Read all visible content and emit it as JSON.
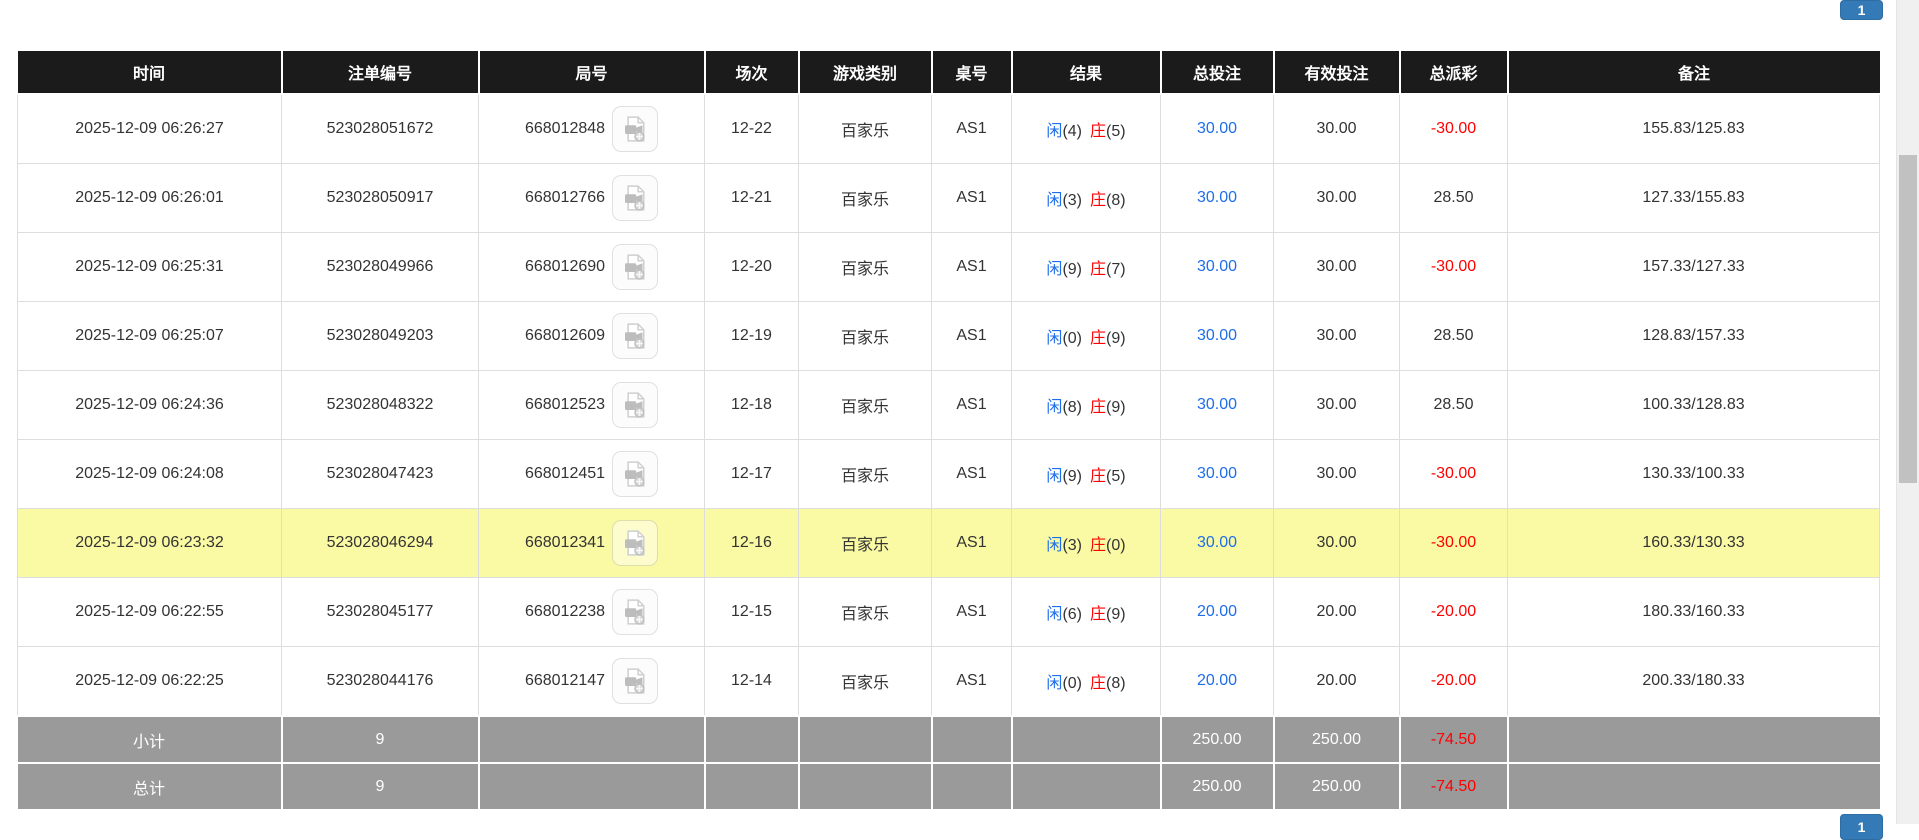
{
  "pagination": {
    "top_label": "1",
    "bottom_label": "1"
  },
  "columns": [
    "时间",
    "注单编号",
    "局号",
    "场次",
    "游戏类别",
    "桌号",
    "结果",
    "总投注",
    "有效投注",
    "总派彩",
    "备注"
  ],
  "rows": [
    {
      "time": "2025-12-09 06:26:27",
      "bet_no": "523028051672",
      "round_no": "668012848",
      "session": "12-22",
      "game": "百家乐",
      "table_no": "AS1",
      "player_label": "闲",
      "player_score": "(4)",
      "banker_label": "庄",
      "banker_score": "(5)",
      "total_bet": "30.00",
      "valid_bet": "30.00",
      "payout": "-30.00",
      "remark": "155.83/125.83"
    },
    {
      "time": "2025-12-09 06:26:01",
      "bet_no": "523028050917",
      "round_no": "668012766",
      "session": "12-21",
      "game": "百家乐",
      "table_no": "AS1",
      "player_label": "闲",
      "player_score": "(3)",
      "banker_label": "庄",
      "banker_score": "(8)",
      "total_bet": "30.00",
      "valid_bet": "30.00",
      "payout": "28.50",
      "remark": "127.33/155.83"
    },
    {
      "time": "2025-12-09 06:25:31",
      "bet_no": "523028049966",
      "round_no": "668012690",
      "session": "12-20",
      "game": "百家乐",
      "table_no": "AS1",
      "player_label": "闲",
      "player_score": "(9)",
      "banker_label": "庄",
      "banker_score": "(7)",
      "total_bet": "30.00",
      "valid_bet": "30.00",
      "payout": "-30.00",
      "remark": "157.33/127.33"
    },
    {
      "time": "2025-12-09 06:25:07",
      "bet_no": "523028049203",
      "round_no": "668012609",
      "session": "12-19",
      "game": "百家乐",
      "table_no": "AS1",
      "player_label": "闲",
      "player_score": "(0)",
      "banker_label": "庄",
      "banker_score": "(9)",
      "total_bet": "30.00",
      "valid_bet": "30.00",
      "payout": "28.50",
      "remark": "128.83/157.33"
    },
    {
      "time": "2025-12-09 06:24:36",
      "bet_no": "523028048322",
      "round_no": "668012523",
      "session": "12-18",
      "game": "百家乐",
      "table_no": "AS1",
      "player_label": "闲",
      "player_score": "(8)",
      "banker_label": "庄",
      "banker_score": "(9)",
      "total_bet": "30.00",
      "valid_bet": "30.00",
      "payout": "28.50",
      "remark": "100.33/128.83"
    },
    {
      "time": "2025-12-09 06:24:08",
      "bet_no": "523028047423",
      "round_no": "668012451",
      "session": "12-17",
      "game": "百家乐",
      "table_no": "AS1",
      "player_label": "闲",
      "player_score": "(9)",
      "banker_label": "庄",
      "banker_score": "(5)",
      "total_bet": "30.00",
      "valid_bet": "30.00",
      "payout": "-30.00",
      "remark": "130.33/100.33"
    },
    {
      "time": "2025-12-09 06:23:32",
      "bet_no": "523028046294",
      "round_no": "668012341",
      "session": "12-16",
      "game": "百家乐",
      "table_no": "AS1",
      "player_label": "闲",
      "player_score": "(3)",
      "banker_label": "庄",
      "banker_score": "(0)",
      "total_bet": "30.00",
      "valid_bet": "30.00",
      "payout": "-30.00",
      "remark": "160.33/130.33",
      "highlighted": true
    },
    {
      "time": "2025-12-09 06:22:55",
      "bet_no": "523028045177",
      "round_no": "668012238",
      "session": "12-15",
      "game": "百家乐",
      "table_no": "AS1",
      "player_label": "闲",
      "player_score": "(6)",
      "banker_label": "庄",
      "banker_score": "(9)",
      "total_bet": "20.00",
      "valid_bet": "20.00",
      "payout": "-20.00",
      "remark": "180.33/160.33"
    },
    {
      "time": "2025-12-09 06:22:25",
      "bet_no": "523028044176",
      "round_no": "668012147",
      "session": "12-14",
      "game": "百家乐",
      "table_no": "AS1",
      "player_label": "闲",
      "player_score": "(0)",
      "banker_label": "庄",
      "banker_score": "(8)",
      "total_bet": "20.00",
      "valid_bet": "20.00",
      "payout": "-20.00",
      "remark": "200.33/180.33"
    }
  ],
  "footer": {
    "subtotal": {
      "label": "小计",
      "count": "9",
      "total_bet": "250.00",
      "valid_bet": "250.00",
      "payout": "-74.50"
    },
    "total": {
      "label": "总计",
      "count": "9",
      "total_bet": "250.00",
      "valid_bet": "250.00",
      "payout": "-74.50"
    }
  },
  "icons": {
    "round_cell_icon": "video-file-icon"
  },
  "colors": {
    "header_bg": "#1b1b1b",
    "highlight_yellow": "#fafaa5",
    "footer_gray": "#9a9a9a",
    "bet_blue": "#1e6eeb",
    "player_blue": "#1e6eeb",
    "banker_red": "#ff0000",
    "negative_red": "#ff0000",
    "pagination_blue": "#337ab7"
  }
}
